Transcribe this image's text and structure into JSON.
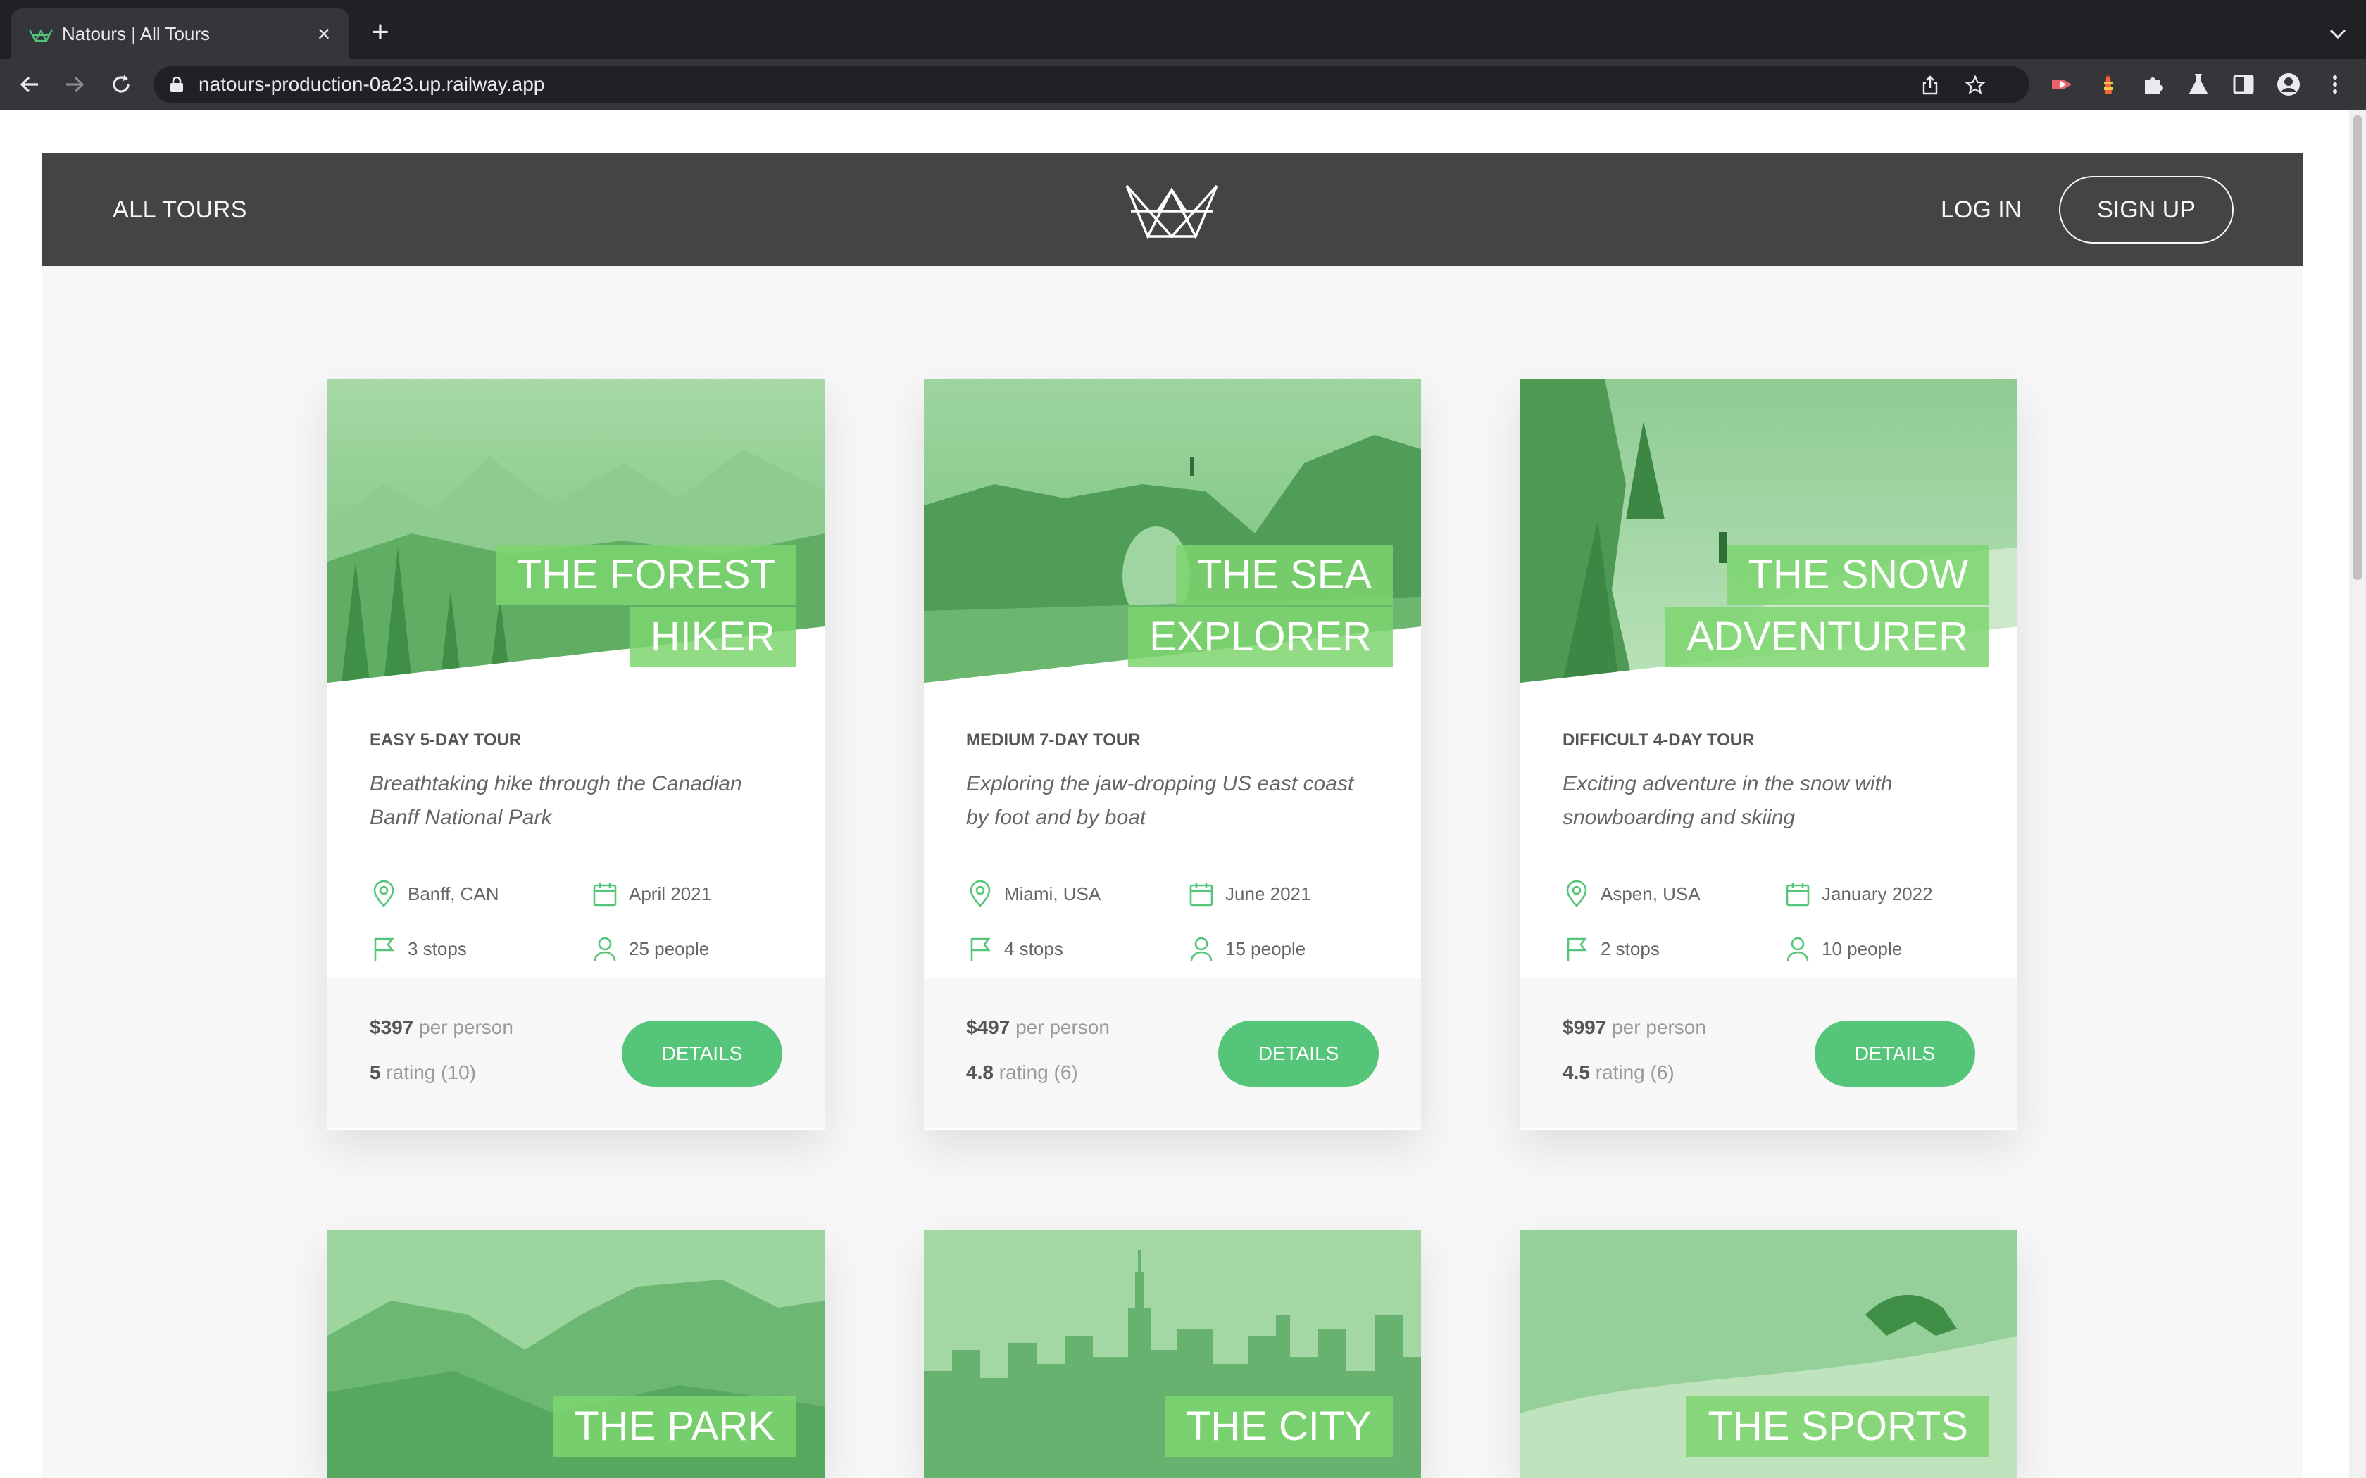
{
  "browser": {
    "tab_title": "Natours | All Tours",
    "url": "natours-production-0a23.up.railway.app"
  },
  "nav": {
    "all_tours": "ALL TOURS",
    "login": "LOG IN",
    "signup": "SIGN UP"
  },
  "colors": {
    "brand": "#55c57a",
    "header": "#444444",
    "background": "#f7f7f7"
  },
  "tours": [
    {
      "title_line1": "THE FOREST",
      "title_line2": "HIKER",
      "difficulty": "EASY 5-DAY TOUR",
      "summary": "Breathtaking hike through the Canadian Banff National Park",
      "location": "Banff, CAN",
      "date": "April 2021",
      "stops": "3 stops",
      "people": "25 people",
      "price": "$397",
      "price_suffix": " per person",
      "rating_value": "5",
      "rating_suffix": " rating (10)",
      "button": "DETAILS"
    },
    {
      "title_line1": "THE SEA",
      "title_line2": "EXPLORER",
      "difficulty": "MEDIUM 7-DAY TOUR",
      "summary": "Exploring the jaw-dropping US east coast by foot and by boat",
      "location": "Miami, USA",
      "date": "June 2021",
      "stops": "4 stops",
      "people": "15 people",
      "price": "$497",
      "price_suffix": " per person",
      "rating_value": "4.8",
      "rating_suffix": " rating (6)",
      "button": "DETAILS"
    },
    {
      "title_line1": "THE SNOW",
      "title_line2": "ADVENTURER",
      "difficulty": "DIFFICULT 4-DAY TOUR",
      "summary": "Exciting adventure in the snow with snowboarding and skiing",
      "location": "Aspen, USA",
      "date": "January 2022",
      "stops": "2 stops",
      "people": "10 people",
      "price": "$997",
      "price_suffix": " per person",
      "rating_value": "4.5",
      "rating_suffix": " rating (6)",
      "button": "DETAILS"
    },
    {
      "title_line1": "THE PARK"
    },
    {
      "title_line1": "THE CITY"
    },
    {
      "title_line1": "THE SPORTS"
    }
  ]
}
